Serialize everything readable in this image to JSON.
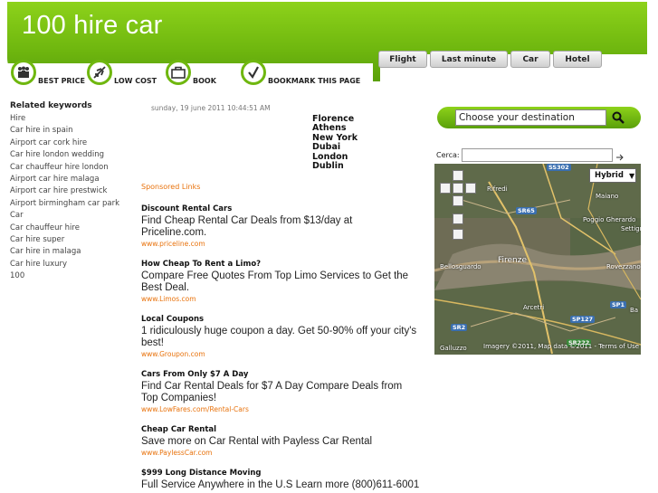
{
  "site": {
    "title": "100 hire car"
  },
  "tabs": [
    "Flight",
    "Last minute",
    "Car",
    "Hotel"
  ],
  "icon_menu": [
    {
      "icon": "people-icon",
      "label": "BEST PRICE"
    },
    {
      "icon": "plane-icon",
      "label": "LOW COST"
    },
    {
      "icon": "bag-icon",
      "label": "BOOK"
    },
    {
      "icon": "check-icon",
      "label": "BOOKMARK THIS PAGE"
    }
  ],
  "related": {
    "heading": "Related keywords",
    "items": [
      "Hire",
      "Car hire in spain",
      "Airport car cork hire",
      "Car hire london wedding",
      "Car chauffeur hire london",
      "Airport car hire malaga",
      "Airport car hire prestwick",
      "Airport birmingham car park",
      "Car",
      "Car chauffeur hire",
      "Car hire super",
      "Car hire in malaga",
      "Car hire luxury",
      "100"
    ]
  },
  "date": "sunday, 19 june 2011 10:44:51 AM",
  "cities": [
    "Florence",
    "Athens",
    "New York",
    "Dubai",
    "London",
    "Dublin"
  ],
  "sponsored_label": "Sponsored Links",
  "ads": [
    {
      "title": "Discount Rental Cars",
      "desc": "Find Cheap Rental Car Deals from $13/day at Priceline.com.",
      "url": "www.priceline.com"
    },
    {
      "title": "How Cheap To Rent a Limo?",
      "desc": "Compare Free Quotes From Top Limo Services to Get the Best Deal.",
      "url": "www.Limos.com"
    },
    {
      "title": "Local Coupons",
      "desc": "1 ridiculously huge coupon a day. Get 50-90% off your city's best!",
      "url": "www.Groupon.com"
    },
    {
      "title": "Cars From Only $7 A Day",
      "desc": "Find Car Rental Deals for $7 A Day Compare Deals from Top Companies!",
      "url": "www.LowFares.com/Rental-Cars"
    },
    {
      "title": "Cheap Car Rental",
      "desc": "Save more on Car Rental with Payless Car Rental",
      "url": "www.PaylessCar.com"
    },
    {
      "title": "$999 Long Distance Moving",
      "desc": "Full Service Anywhere in the U.S Learn more (800)611-6001",
      "url": ""
    }
  ],
  "destination": {
    "selected": "Choose your destination"
  },
  "search": {
    "label": "Cerca:"
  },
  "map": {
    "type_button": "Hybrid",
    "labels": [
      "Rifredi",
      "Maiano",
      "Poggio Gherardo",
      "Settign",
      "Firenze",
      "Bellosguardo",
      "Rovezzano",
      "Arcetri",
      "Galluzzo",
      "Ba"
    ],
    "road_badges": [
      "SS302",
      "SR65",
      "SP1",
      "SP127",
      "SR2",
      "SR222"
    ],
    "footer": "Imagery ©2011, Map data ©2011 - Terms of Use"
  }
}
